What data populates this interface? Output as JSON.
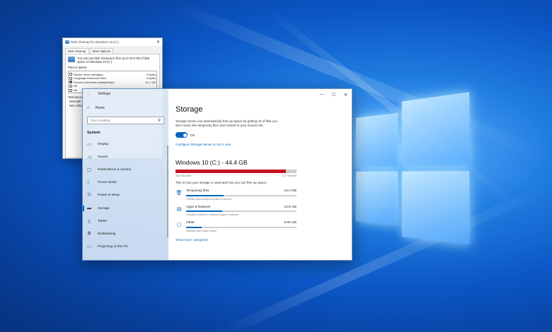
{
  "disk_cleanup": {
    "title": "Disk Cleanup for Windows 10 (C:)",
    "close_glyph": "✕",
    "tabs": [
      "Disk Cleanup",
      "More Options"
    ],
    "intro": "You can use Disk Cleanup to free up to 19.9 GB of disk space on Windows 10 (C:).",
    "files_label": "Files to delete:",
    "items": [
      {
        "name": "Device driver packages",
        "size": "0 bytes"
      },
      {
        "name": "Language Resource Files",
        "size": "0 bytes"
      },
      {
        "name": "Previous Windows installation(s)",
        "size": "10.7 GB"
      },
      {
        "name": "Re",
        "size": ""
      },
      {
        "name": "Ne",
        "size": ""
      }
    ],
    "total_label": "Total amou",
    "desc_label": "Descripti",
    "desc_text": "Non critica"
  },
  "settings": {
    "window_title": "Settings",
    "back_glyph": "←",
    "home_label": "Home",
    "search_placeholder": "Find a setting",
    "section": "System",
    "nav_items": [
      {
        "label": "Display",
        "icon": "▭"
      },
      {
        "label": "Sound",
        "icon": "◁"
      },
      {
        "label": "Notifications & actions",
        "icon": "▢"
      },
      {
        "label": "Focus assist",
        "icon": "☾"
      },
      {
        "label": "Power & sleep",
        "icon": "⏻"
      },
      {
        "label": "Storage",
        "icon": "▬"
      },
      {
        "label": "Tablet",
        "icon": "▯"
      },
      {
        "label": "Multitasking",
        "icon": "⧉"
      },
      {
        "label": "Projecting to this PC",
        "icon": "▭"
      }
    ],
    "caption_buttons": [
      "—",
      "☐",
      "✕"
    ],
    "page_title": "Storage",
    "sense_desc": "Storage Sense can automatically free up space by getting rid of files you don't need, like temporary files and content in your recycle bin.",
    "toggle_label": "On",
    "configure_link": "Configure Storage Sense or run it now",
    "drive_title": "Windows 10 (C:) - 44.4 GB",
    "used_label": "40.6 GB used",
    "free_label": "3.72 GB free",
    "used_fraction": 0.915,
    "how_text": "This is how your storage is used and how you can free up space.",
    "categories": [
      {
        "icon": "🗑",
        "name": "Temporary files",
        "size": "14.0 GB",
        "fraction": 0.34,
        "sub": "Choose which temporary files to remove"
      },
      {
        "icon": "▤",
        "name": "Apps & features",
        "size": "13.8 GB",
        "fraction": 0.33,
        "sub": "Uninstall unused or undesired apps & features"
      },
      {
        "icon": "▢",
        "name": "Other",
        "size": "5.60 GB",
        "fraction": 0.14,
        "sub": "Manage other large folders"
      }
    ],
    "more_link": "Show more categories"
  },
  "colors": {
    "accent": "#0067c0",
    "used_bar": "#c50f1f"
  }
}
